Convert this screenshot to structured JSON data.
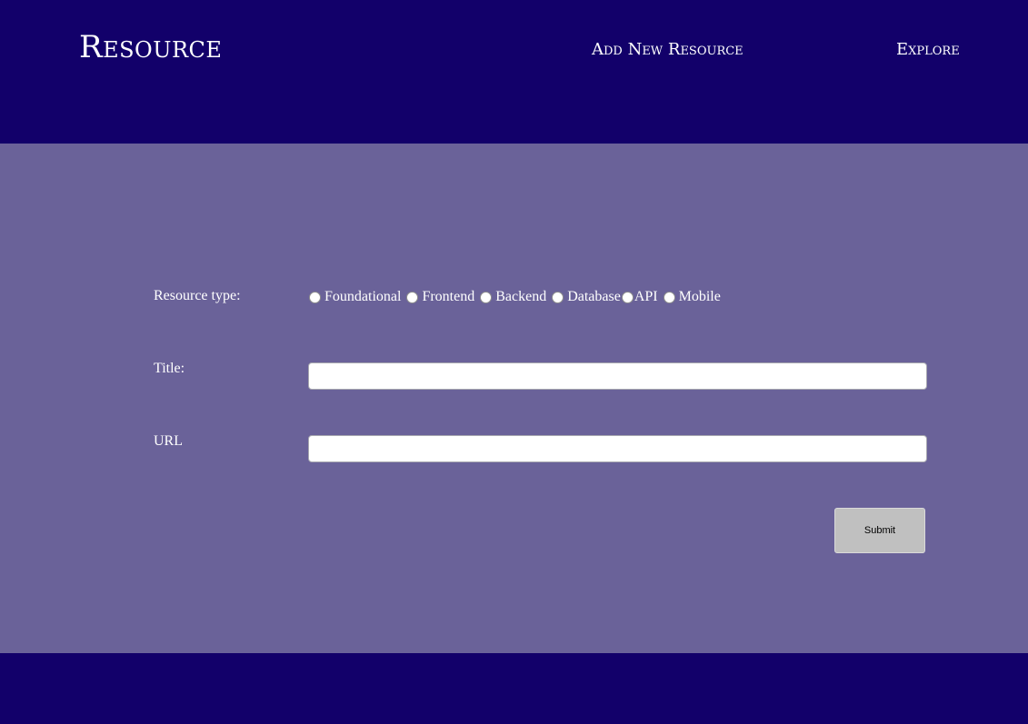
{
  "header": {
    "brand": "Resource",
    "nav": {
      "add_new": "Add New Resource",
      "explore": "Explore"
    }
  },
  "form": {
    "resource_type_label": "Resource type:",
    "resource_types": [
      "Foundational",
      "Frontend",
      "Backend",
      "Database",
      "API",
      "Mobile"
    ],
    "title_label": "Title:",
    "title_value": "",
    "url_label": "URL",
    "url_value": "",
    "submit_label": "Submit"
  },
  "colors": {
    "header_bg": "#12006a",
    "main_bg": "#6a6299",
    "button_bg": "#c0c0c0"
  }
}
